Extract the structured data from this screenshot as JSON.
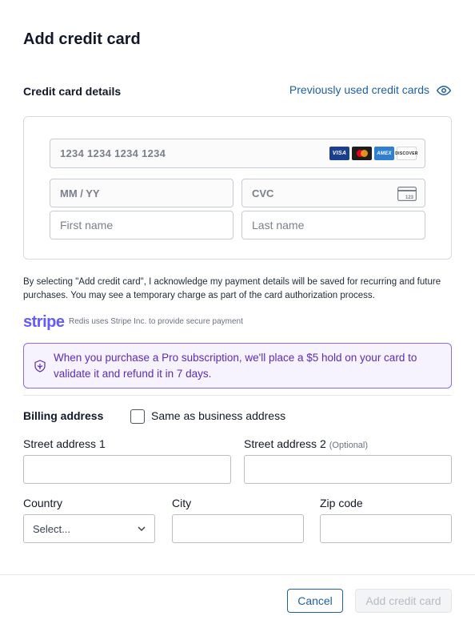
{
  "dialog": {
    "title": "Add credit card"
  },
  "card_section": {
    "label": "Credit card details",
    "previous_link": "Previously used credit cards",
    "card_number_placeholder": "1234 1234 1234 1234",
    "expiry_placeholder": "MM / YY",
    "cvc_placeholder": "CVC",
    "first_name_placeholder": "First name",
    "last_name_placeholder": "Last name",
    "brands": [
      "VISA",
      "Mastercard",
      "AMEX",
      "DISCOVER"
    ],
    "cvc_icon_text": "123"
  },
  "disclaimer": "By selecting \"Add credit card\", I acknowledge my payment details will be saved for recurring and future purchases. You may see a temporary charge as part of the card authorization process.",
  "stripe": {
    "logo": "stripe",
    "text": "Redis uses Stripe Inc. to provide secure payment"
  },
  "notice": {
    "text": "When you purchase a Pro subscription, we'll place a $5 hold on your card to validate it and refund it in 7 days."
  },
  "billing": {
    "label": "Billing address",
    "same_as_business_label": "Same as business address",
    "same_as_business_checked": false,
    "street1_label": "Street address 1",
    "street2_label": "Street address 2",
    "street2_optional": "(Optional)",
    "country_label": "Country",
    "country_value": "Select...",
    "city_label": "City",
    "zip_label": "Zip code"
  },
  "footer": {
    "cancel_label": "Cancel",
    "add_label": "Add credit card"
  },
  "colors": {
    "link": "#1f5ea8",
    "stripe": "#635bff",
    "notice_border": "#8a6cf0",
    "notice_text": "#5b2bb5"
  }
}
